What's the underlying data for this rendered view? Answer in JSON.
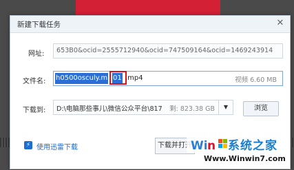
{
  "dialog": {
    "title": "新建下载任务",
    "close_glyph": "✕"
  },
  "url": {
    "label": "网址:",
    "value": "653B0&ocid=2555712940&ocid=747509164&ocid=1469243914"
  },
  "filename": {
    "label": "文件名:",
    "selected_text": "h0500osculy.m",
    "highlighted_text": "01",
    "extension": ".mp4",
    "type_size": "视频 6.60 MB"
  },
  "download_to": {
    "label": "下载到:",
    "path": "D:\\电脑那些事儿\\微信公众平台\\817",
    "free_space": "剩: 823.38 GB",
    "dropdown_glyph": "▼",
    "browse_label": "浏览"
  },
  "footer": {
    "thunder_icon_glyph": "⚡",
    "use_thunder_label": "使用迅雷下载",
    "download_open_label": "下载并打开"
  },
  "watermark": {
    "brand": "系统之家",
    "url": "Www.Winwin7.com"
  },
  "colors": {
    "accent": "#2b6fd6",
    "highlight_box": "#e0101a",
    "link": "#1d68c8"
  }
}
